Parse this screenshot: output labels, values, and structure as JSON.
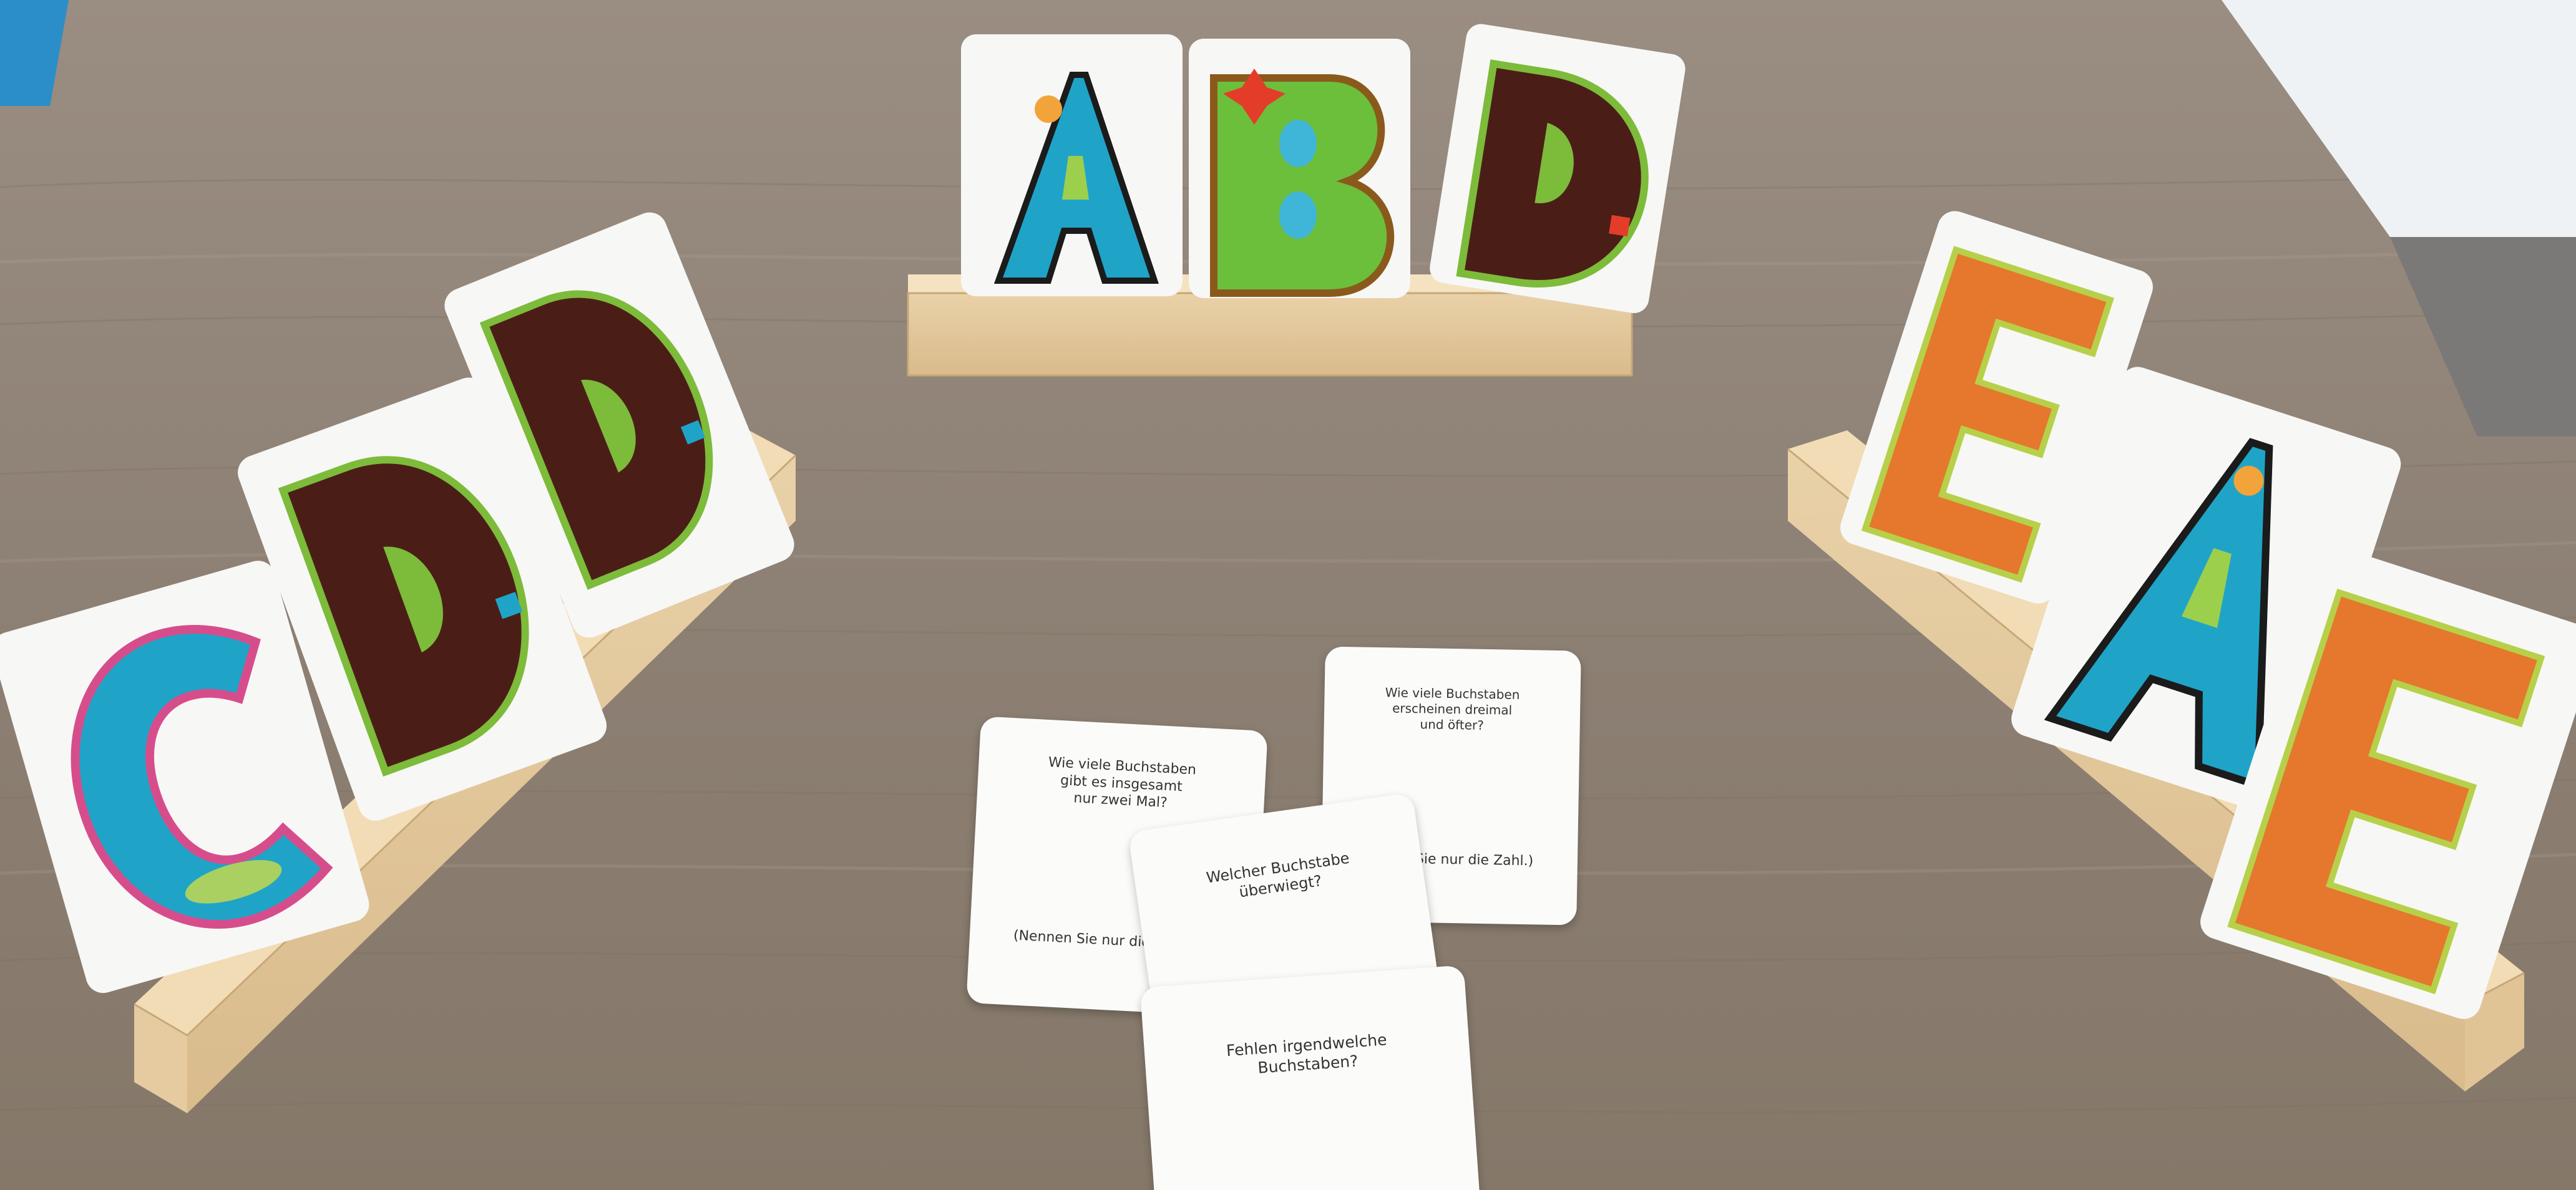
{
  "scene": {
    "description_colors": {
      "table": "#8f8276",
      "table_light": "#a99c8f",
      "holder_wood": "#e8cfa6",
      "card_white": "#f6f6f4",
      "letter_blue": "#1fa4c8",
      "letter_green": "#6cbf3a",
      "letter_brown": "#4a1e17",
      "letter_orange": "#e5782d",
      "letter_pink": "#d64d8c"
    },
    "holders": {
      "left": {
        "letters": [
          "C",
          "D",
          "D"
        ]
      },
      "center": {
        "letters": [
          "A",
          "B",
          "D"
        ]
      },
      "right": {
        "letters": [
          "E",
          "A",
          "E"
        ]
      }
    },
    "question_cards": {
      "card1": {
        "line1": "Wie viele Buchstaben\ngibt es insgesamt\nnur zwei Mal?",
        "line2": "(Nennen Sie nur die"
      },
      "card2": {
        "line1": "Wie viele Buchstaben\nerscheinen dreimal\nund öfter?",
        "line2": "Sie nur die Zahl.)"
      },
      "card3": {
        "line1": "Welcher Buchstabe\nüberwiegt?"
      },
      "card4": {
        "line1": "Fehlen irgendwelche\nBuchstaben?"
      }
    }
  }
}
